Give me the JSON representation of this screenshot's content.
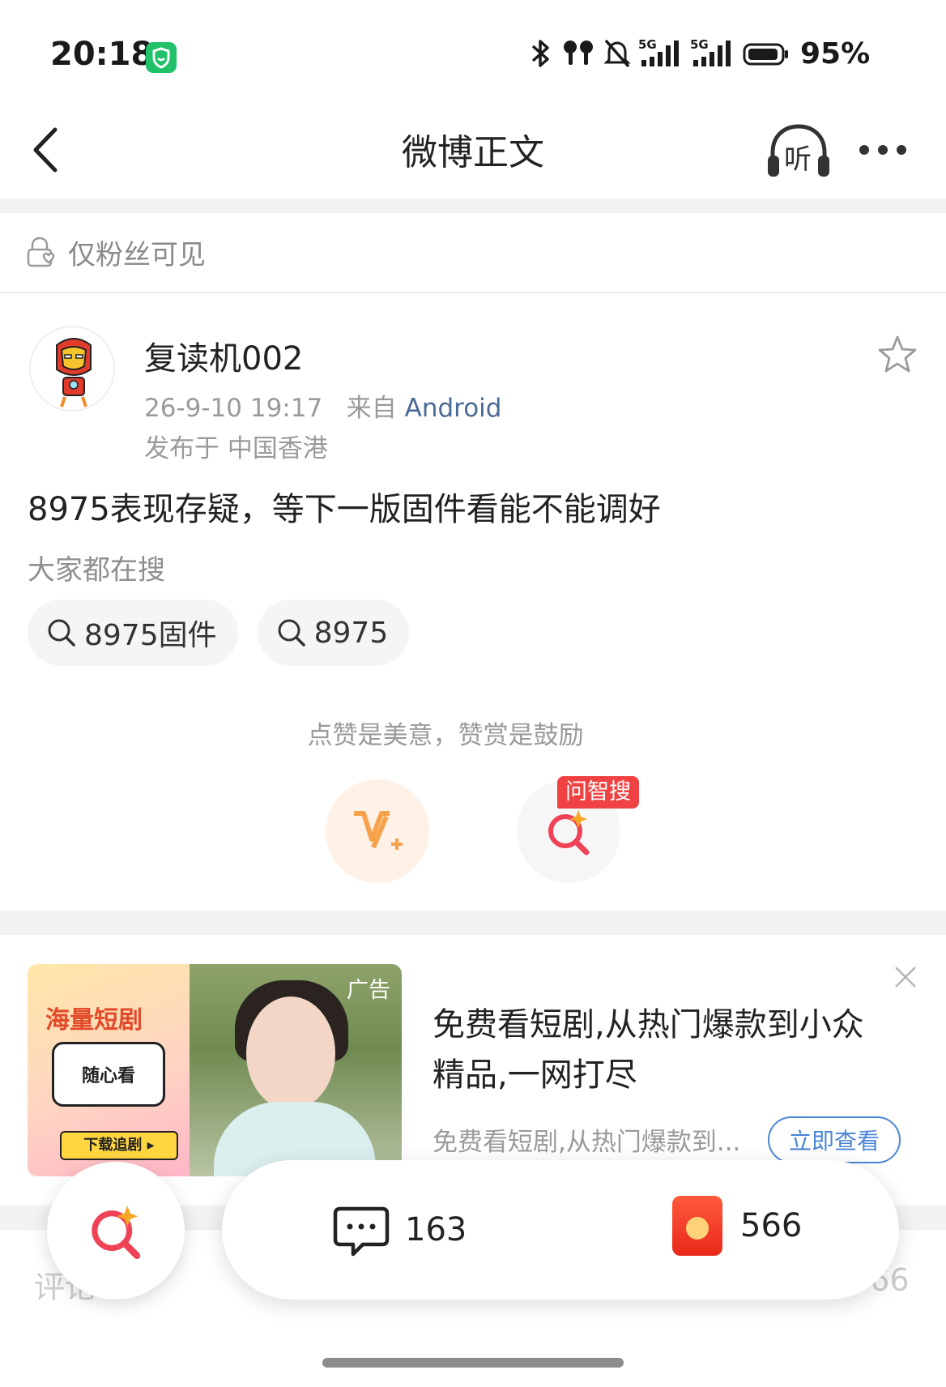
{
  "status_bar": {
    "time": "20:18",
    "app_icon": "shield-app-icon",
    "icons": [
      "bluetooth-icon",
      "earbuds-icon",
      "mute-icon",
      "signal-5g-icon",
      "signal-5g-icon",
      "battery-icon"
    ],
    "network_labels": [
      "5G",
      "5G"
    ],
    "battery": "95%"
  },
  "header": {
    "title": "微博正文",
    "back_icon": "chevron-left-icon",
    "listen_label": "听",
    "more_icon": "more-dots-icon"
  },
  "visibility": {
    "icon": "lock-heart-icon",
    "label": "仅粉丝可见"
  },
  "post": {
    "username": "复读机002",
    "timestamp": "26-9-10 19:17",
    "source_prefix": "来自",
    "source": "Android",
    "location": "发布于 中国香港",
    "text": "8975表现存疑，等下一版固件看能不能调好"
  },
  "search_suggest": {
    "label": "大家都在搜",
    "chips": [
      {
        "label": "8975固件"
      },
      {
        "label": "8975"
      }
    ]
  },
  "praise": {
    "hint": "点赞是美意，赞赏是鼓励",
    "ai_search_tag": "问智搜"
  },
  "ad": {
    "badge": "广告",
    "image_slogan": "海量短剧",
    "image_bubble": "随心看",
    "image_download": "下载追剧 ▸",
    "title": "免费看短剧,从热门爆款到小众精品,一网打尽",
    "description": "免费看短剧,从热门爆款到...",
    "cta": "立即查看"
  },
  "comments_tab": {
    "label": "评论",
    "likes_count_partial": "566"
  },
  "action_bar": {
    "comment_count": "163",
    "hongbao_count": "566"
  },
  "colors": {
    "accent_red": "#f04242",
    "link_blue": "#4b86d6",
    "reward_orange": "#f5a24b"
  }
}
